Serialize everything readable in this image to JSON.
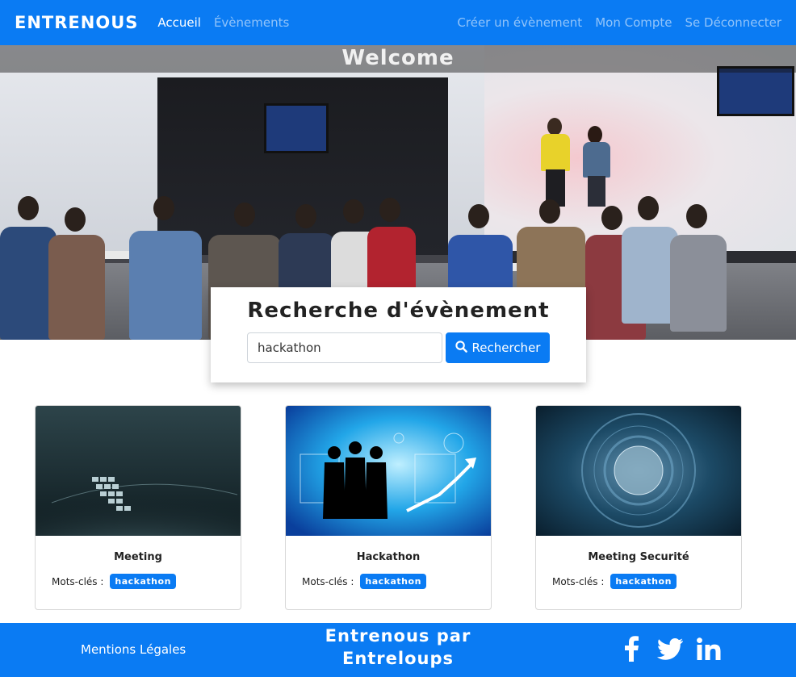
{
  "navbar": {
    "brand": "ENTRENOUS",
    "links_left": [
      {
        "label": "Accueil",
        "active": true
      },
      {
        "label": "Évènements",
        "active": false
      }
    ],
    "links_right": [
      {
        "label": "Créer un évènement"
      },
      {
        "label": "Mon Compte"
      },
      {
        "label": "Se Déconnecter"
      }
    ]
  },
  "hero": {
    "welcome": "Welcome"
  },
  "search": {
    "title": "Recherche d'évènement",
    "value": "hackathon",
    "button_label": "Rechercher",
    "button_icon": "search-icon"
  },
  "events": [
    {
      "title": "Meeting",
      "keywords_label": "Mots-clés :",
      "keyword": "hackathon"
    },
    {
      "title": "Hackathon",
      "keywords_label": "Mots-clés :",
      "keyword": "hackathon"
    },
    {
      "title": "Meeting Securité",
      "keywords_label": "Mots-clés :",
      "keyword": "hackathon"
    }
  ],
  "footer": {
    "legal": "Mentions Légales",
    "title_line1": "Entrenous par",
    "title_line2": "Entreloups",
    "socials": [
      "facebook-icon",
      "twitter-icon",
      "linkedin-icon"
    ]
  },
  "colors": {
    "primary": "#0a7bf3"
  }
}
